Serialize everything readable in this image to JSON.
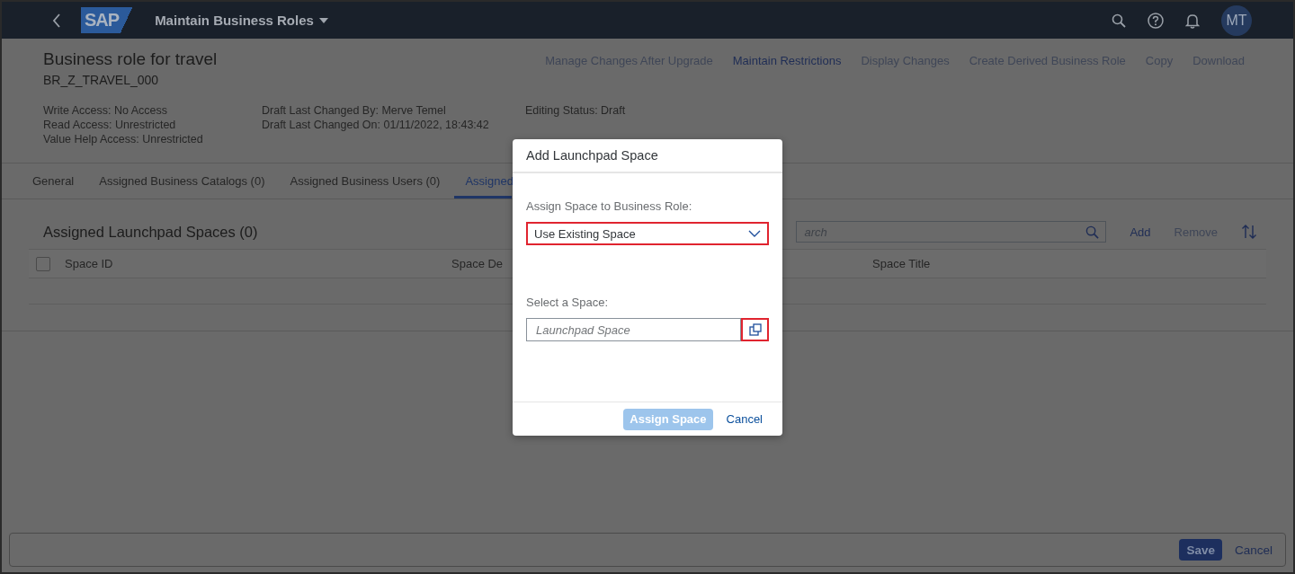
{
  "shell": {
    "logo": "SAP",
    "title": "Maintain Business Roles",
    "avatar": "MT"
  },
  "header": {
    "title": "Business role for travel",
    "subtitle": "BR_Z_TRAVEL_000",
    "actions": [
      {
        "label": "Manage Changes After Upgrade",
        "disabled": true
      },
      {
        "label": "Maintain Restrictions",
        "disabled": false
      },
      {
        "label": "Display Changes",
        "disabled": true
      },
      {
        "label": "Create Derived Business Role",
        "disabled": true
      },
      {
        "label": "Copy",
        "disabled": true
      },
      {
        "label": "Download",
        "disabled": true
      }
    ],
    "attribute_groups": [
      [
        "Write Access: No Access",
        "Read Access: Unrestricted",
        "Value Help Access: Unrestricted"
      ],
      [
        "Draft Last Changed By: Merve Temel",
        "Draft Last Changed On: 01/11/2022, 18:43:42"
      ],
      [
        "Editing Status: Draft"
      ]
    ]
  },
  "tabs": [
    {
      "label": "General",
      "selected": false
    },
    {
      "label": "Assigned Business Catalogs (0)",
      "selected": false
    },
    {
      "label": "Assigned Business Users (0)",
      "selected": false
    },
    {
      "label": "Assigned",
      "selected": true
    }
  ],
  "section": {
    "title": "Assigned Launchpad Spaces (0)",
    "search": {
      "placeholder": "arch"
    },
    "toolbar_buttons": [
      {
        "label": "Add",
        "disabled": false
      },
      {
        "label": "Remove",
        "disabled": true
      }
    ],
    "table": {
      "select_all_checked": false,
      "columns": [
        "Space ID",
        "Space De",
        "Space Title"
      ]
    }
  },
  "footer": {
    "buttons": [
      {
        "label": "Save",
        "kind": "emphasized"
      },
      {
        "label": "Cancel",
        "kind": "transparent"
      }
    ]
  },
  "dialog": {
    "title": "Add Launchpad Space",
    "fields": [
      {
        "kind": "select",
        "label": "Assign Space to Business Role:",
        "value": "Use Existing Space",
        "highlighted": true
      },
      {
        "kind": "valuehelp",
        "label": "Select a Space:",
        "placeholder": "Launchpad Space",
        "highlighted": true
      }
    ],
    "buttons": [
      {
        "label": "Assign Space",
        "kind": "emphasized",
        "disabled": true
      },
      {
        "label": "Cancel",
        "kind": "transparent",
        "disabled": false
      }
    ]
  }
}
